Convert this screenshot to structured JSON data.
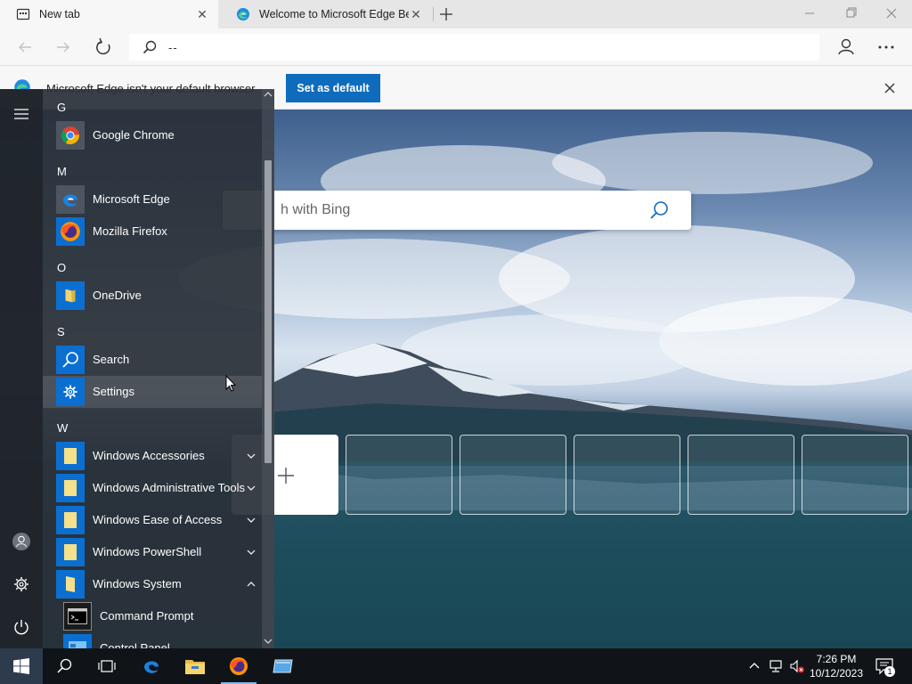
{
  "browser": {
    "tabs": [
      {
        "title": "New tab",
        "active": true
      },
      {
        "title": "Welcome to Microsoft Edge Beta",
        "active": false
      }
    ],
    "address": "--",
    "infobar": {
      "message": "Microsoft Edge isn't your default browser",
      "button": "Set as default"
    },
    "search_placeholder": "Search the web with Bing",
    "search_placeholder_visible": "h with Bing"
  },
  "start_menu": {
    "sections": [
      {
        "letter": "G",
        "items": [
          {
            "label": "Google Chrome",
            "icon": "chrome-icon"
          }
        ]
      },
      {
        "letter": "M",
        "items": [
          {
            "label": "Microsoft Edge",
            "icon": "edge-icon"
          },
          {
            "label": "Mozilla Firefox",
            "icon": "firefox-icon"
          }
        ]
      },
      {
        "letter": "O",
        "items": [
          {
            "label": "OneDrive",
            "icon": "onedrive-icon"
          }
        ]
      },
      {
        "letter": "S",
        "items": [
          {
            "label": "Search",
            "icon": "search-icon"
          },
          {
            "label": "Settings",
            "icon": "gear-icon"
          }
        ]
      },
      {
        "letter": "W",
        "items": [
          {
            "label": "Windows Accessories",
            "icon": "folder-icon",
            "expandable": "collapsed"
          },
          {
            "label": "Windows Administrative Tools",
            "icon": "folder-icon",
            "expandable": "collapsed"
          },
          {
            "label": "Windows Ease of Access",
            "icon": "folder-icon",
            "expandable": "collapsed"
          },
          {
            "label": "Windows PowerShell",
            "icon": "folder-icon",
            "expandable": "collapsed"
          },
          {
            "label": "Windows System",
            "icon": "folder-icon",
            "expandable": "expanded"
          },
          {
            "label": "Command Prompt",
            "icon": "cmd-icon"
          },
          {
            "label": "Control Panel",
            "icon": "control-panel-icon"
          }
        ]
      }
    ]
  },
  "taskbar": {
    "time": "7:26 PM",
    "date": "10/12/2023",
    "notification_count": "1"
  },
  "colors": {
    "accent": "#0f6cbd",
    "start_tile_blue": "#0b6fd1",
    "taskbar": "#101418"
  }
}
